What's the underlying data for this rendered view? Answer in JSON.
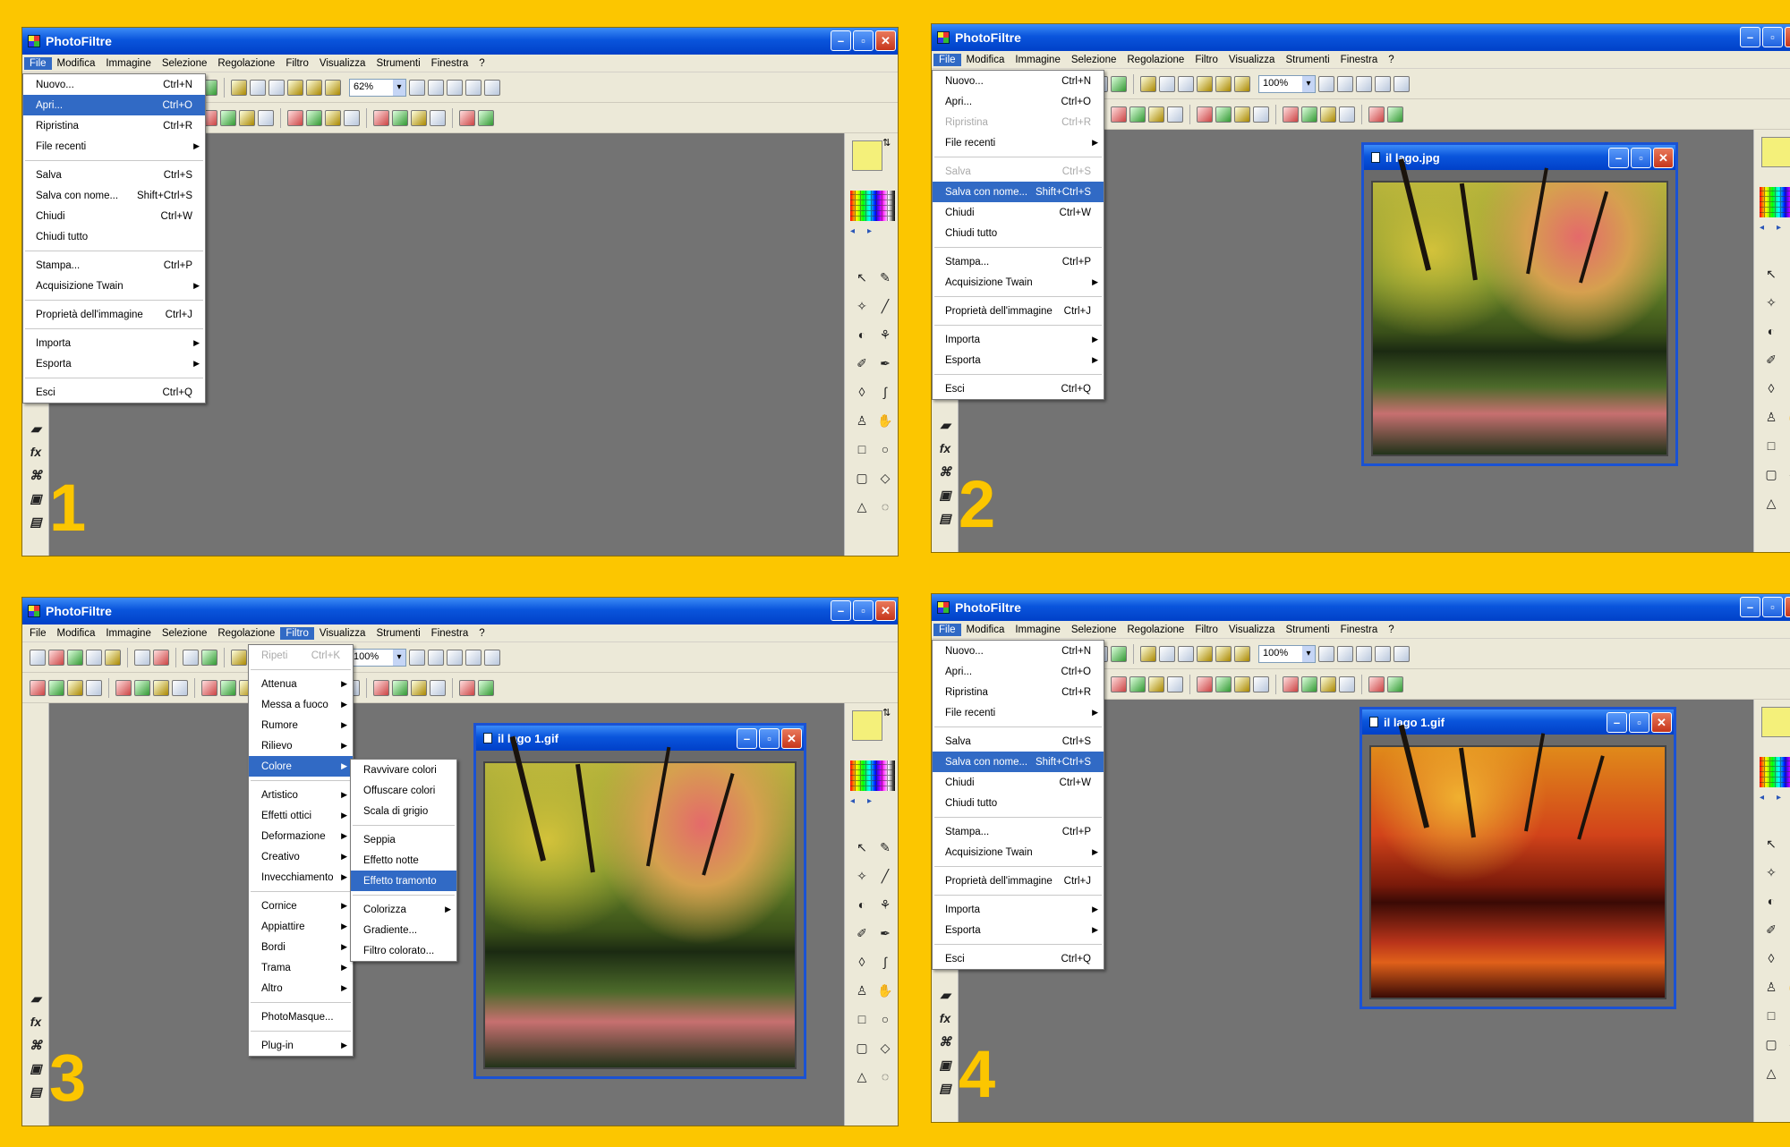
{
  "app": {
    "title": "PhotoFiltre",
    "menus": [
      "File",
      "Modifica",
      "Immagine",
      "Selezione",
      "Regolazione",
      "Filtro",
      "Visualizza",
      "Strumenti",
      "Finestra",
      "?"
    ]
  },
  "steps": [
    "1",
    "2",
    "3",
    "4"
  ],
  "panel1": {
    "zoom": "62%",
    "active_menu": "File",
    "file_menu": [
      {
        "label": "Nuovo...",
        "shortcut": "Ctrl+N"
      },
      {
        "label": "Apri...",
        "shortcut": "Ctrl+O",
        "highlighted": true
      },
      {
        "label": "Ripristina",
        "shortcut": "Ctrl+R"
      },
      {
        "label": "File recenti",
        "submenu": true
      },
      {
        "label": "Salva",
        "shortcut": "Ctrl+S"
      },
      {
        "label": "Salva con nome...",
        "shortcut": "Shift+Ctrl+S"
      },
      {
        "label": "Chiudi",
        "shortcut": "Ctrl+W"
      },
      {
        "label": "Chiudi tutto"
      },
      {
        "label": "Stampa...",
        "shortcut": "Ctrl+P"
      },
      {
        "label": "Acquisizione Twain",
        "submenu": true
      },
      {
        "label": "Proprietà dell'immagine",
        "shortcut": "Ctrl+J"
      },
      {
        "label": "Importa",
        "submenu": true
      },
      {
        "label": "Esporta",
        "submenu": true
      },
      {
        "label": "Esci",
        "shortcut": "Ctrl+Q"
      }
    ]
  },
  "panel2": {
    "zoom": "100%",
    "active_menu": "File",
    "document_title": "il lago.jpg",
    "file_menu": [
      {
        "label": "Nuovo...",
        "shortcut": "Ctrl+N"
      },
      {
        "label": "Apri...",
        "shortcut": "Ctrl+O"
      },
      {
        "label": "Ripristina",
        "shortcut": "Ctrl+R",
        "disabled": true
      },
      {
        "label": "File recenti",
        "submenu": true
      },
      {
        "label": "Salva",
        "shortcut": "Ctrl+S",
        "disabled": true
      },
      {
        "label": "Salva con nome...",
        "shortcut": "Shift+Ctrl+S",
        "highlighted": true
      },
      {
        "label": "Chiudi",
        "shortcut": "Ctrl+W"
      },
      {
        "label": "Chiudi tutto"
      },
      {
        "label": "Stampa...",
        "shortcut": "Ctrl+P"
      },
      {
        "label": "Acquisizione Twain",
        "submenu": true
      },
      {
        "label": "Proprietà dell'immagine",
        "shortcut": "Ctrl+J"
      },
      {
        "label": "Importa",
        "submenu": true
      },
      {
        "label": "Esporta",
        "submenu": true
      },
      {
        "label": "Esci",
        "shortcut": "Ctrl+Q"
      }
    ]
  },
  "panel3": {
    "zoom": "100%",
    "active_menu": "Filtro",
    "document_title": "il lago 1.gif",
    "filtro_menu": [
      {
        "label": "Ripeti",
        "shortcut": "Ctrl+K",
        "disabled": true
      },
      {
        "label": "Attenua",
        "submenu": true
      },
      {
        "label": "Messa a fuoco",
        "submenu": true
      },
      {
        "label": "Rumore",
        "submenu": true
      },
      {
        "label": "Rilievo",
        "submenu": true
      },
      {
        "label": "Colore",
        "submenu": true,
        "highlighted": true
      },
      {
        "label": "Artistico",
        "submenu": true
      },
      {
        "label": "Effetti ottici",
        "submenu": true
      },
      {
        "label": "Deformazione",
        "submenu": true
      },
      {
        "label": "Creativo",
        "submenu": true
      },
      {
        "label": "Invecchiamento",
        "submenu": true
      },
      {
        "label": "Cornice",
        "submenu": true
      },
      {
        "label": "Appiattire",
        "submenu": true
      },
      {
        "label": "Bordi",
        "submenu": true
      },
      {
        "label": "Trama",
        "submenu": true
      },
      {
        "label": "Altro",
        "submenu": true
      },
      {
        "label": "PhotoMasque..."
      },
      {
        "label": "Plug-in",
        "submenu": true
      }
    ],
    "colore_submenu": [
      {
        "label": "Ravvivare colori"
      },
      {
        "label": "Offuscare colori"
      },
      {
        "label": "Scala di grigio"
      },
      {
        "label": "Seppia"
      },
      {
        "label": "Effetto notte"
      },
      {
        "label": "Effetto tramonto",
        "highlighted": true
      },
      {
        "label": "Colorizza",
        "submenu": true
      },
      {
        "label": "Gradiente..."
      },
      {
        "label": "Filtro colorato..."
      }
    ]
  },
  "panel4": {
    "zoom": "100%",
    "active_menu": "File",
    "document_title": "il lago 1.gif",
    "file_menu": [
      {
        "label": "Nuovo...",
        "shortcut": "Ctrl+N"
      },
      {
        "label": "Apri...",
        "shortcut": "Ctrl+O"
      },
      {
        "label": "Ripristina",
        "shortcut": "Ctrl+R"
      },
      {
        "label": "File recenti",
        "submenu": true
      },
      {
        "label": "Salva",
        "shortcut": "Ctrl+S"
      },
      {
        "label": "Salva con nome...",
        "shortcut": "Shift+Ctrl+S",
        "highlighted": true
      },
      {
        "label": "Chiudi",
        "shortcut": "Ctrl+W"
      },
      {
        "label": "Chiudi tutto"
      },
      {
        "label": "Stampa...",
        "shortcut": "Ctrl+P"
      },
      {
        "label": "Acquisizione Twain",
        "submenu": true
      },
      {
        "label": "Proprietà dell'immagine",
        "shortcut": "Ctrl+J"
      },
      {
        "label": "Importa",
        "submenu": true
      },
      {
        "label": "Esporta",
        "submenu": true
      },
      {
        "label": "Esci",
        "shortcut": "Ctrl+Q"
      }
    ]
  },
  "colors": {
    "background": "#FCC600",
    "titlebar": "#0a55dc",
    "menu_highlight": "#316ac5",
    "workspace": "#737373"
  }
}
